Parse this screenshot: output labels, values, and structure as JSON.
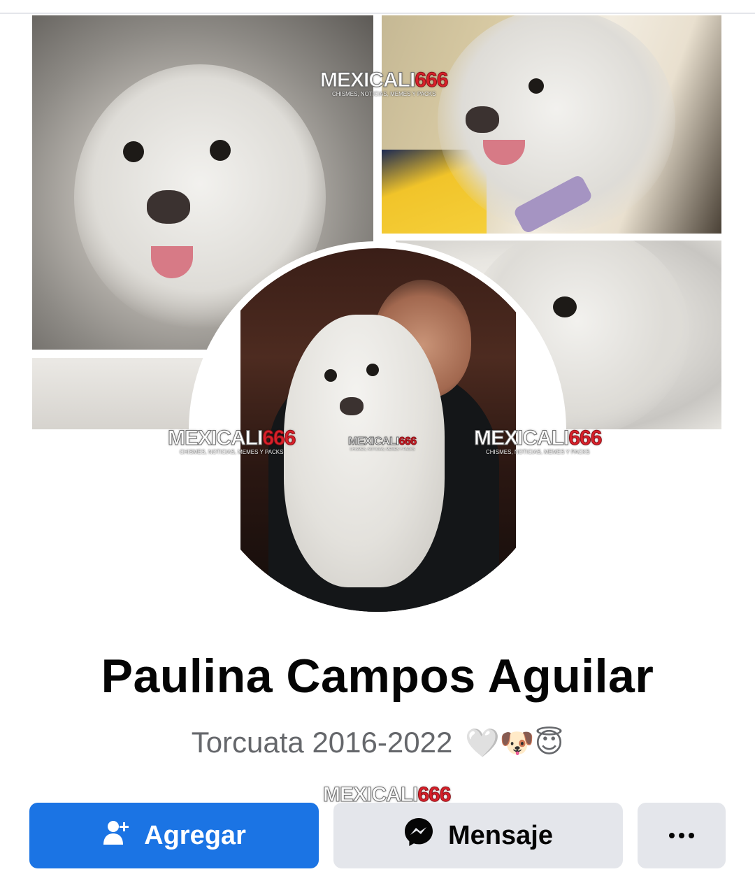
{
  "cover": {
    "watermarks": [
      {
        "brand_white": "MEXICALI",
        "brand_red": "666",
        "tagline": "CHISMES, NOTICIAS, MEMES Y PACKS"
      }
    ]
  },
  "profile": {
    "name": "Paulina Campos Aguilar",
    "bio": "Torcuata 2016-2022",
    "bio_emojis": "🤍🐶😇"
  },
  "actions": {
    "add_label": "Agregar",
    "message_label": "Mensaje",
    "more_label": "•••"
  },
  "colors": {
    "primary_button": "#1b74e4",
    "secondary_button": "#e4e6eb",
    "name_text": "#050505",
    "bio_text": "#65676b",
    "watermark_red": "#d9202a"
  }
}
